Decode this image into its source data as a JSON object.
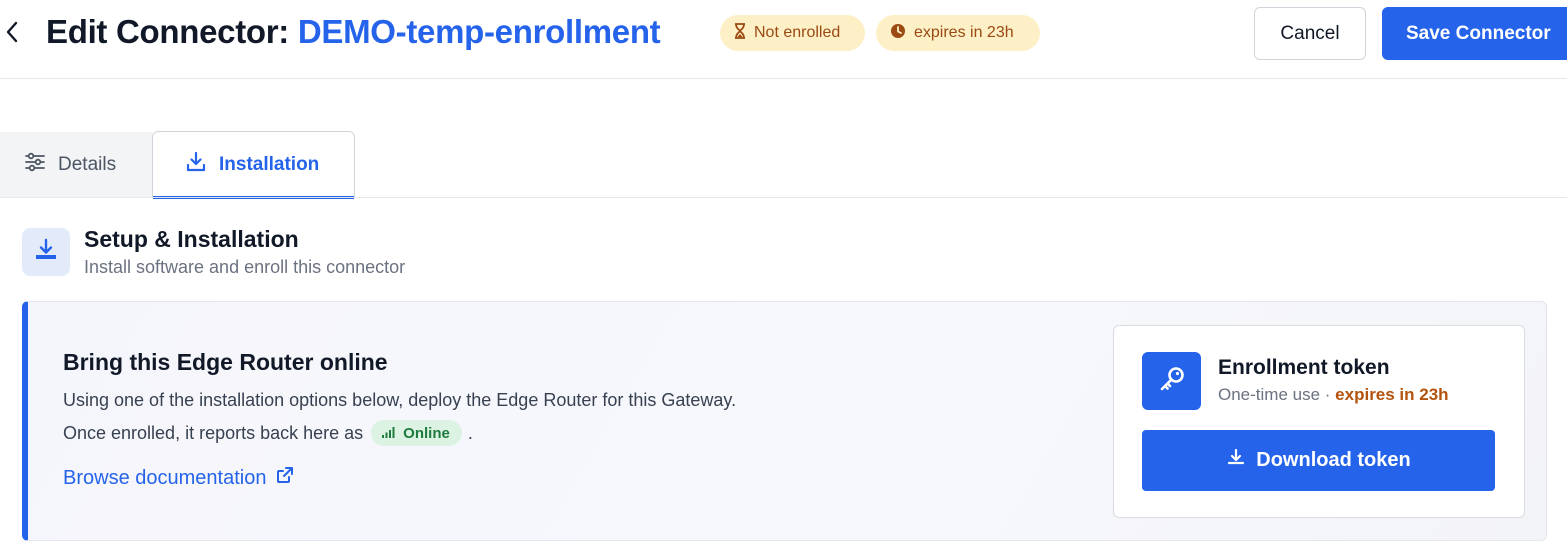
{
  "header": {
    "title_prefix": "Edit Connector:",
    "connector_name": "DEMO-temp-enrollment",
    "badges": {
      "status": "Not enrolled",
      "expiry": "expires in 23h"
    },
    "cancel_label": "Cancel",
    "save_label": "Save Connector"
  },
  "tabs": [
    {
      "label": "Details",
      "active": false,
      "icon": "sliders-icon"
    },
    {
      "label": "Installation",
      "active": true,
      "icon": "download-icon"
    }
  ],
  "section": {
    "title": "Setup & Installation",
    "subtitle": "Install software and enroll this connector"
  },
  "card": {
    "title": "Bring this Edge Router online",
    "line1": "Using one of the installation options below, deploy the Edge Router for this Gateway.",
    "line2_prefix": "Once enrolled, it reports back here as",
    "online_label": "Online",
    "line2_suffix": ".",
    "doc_link": "Browse documentation"
  },
  "token": {
    "title": "Enrollment token",
    "subtitle_prefix": "One-time use ·",
    "expiry": "expires in 23h",
    "download_label": "Download token"
  },
  "colors": {
    "accent": "#2563eb",
    "badge_bg": "#fdf0c7",
    "badge_text": "#9a4a12",
    "online_bg": "#dcf3e3",
    "online_text": "#1f7a3d"
  }
}
